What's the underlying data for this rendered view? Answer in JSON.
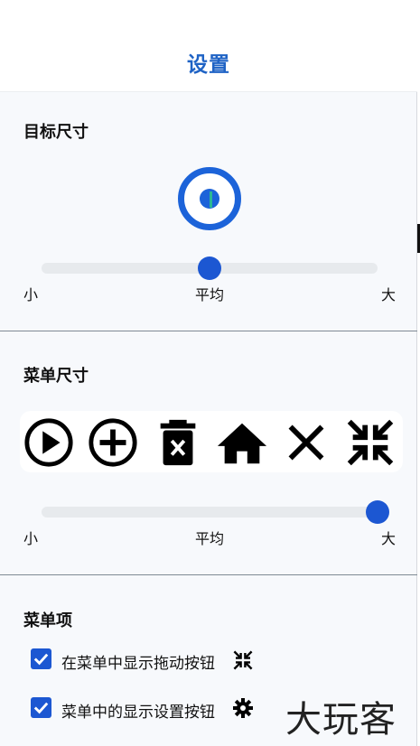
{
  "header": {
    "title": "设置"
  },
  "target_size": {
    "title": "目标尺寸",
    "slider": {
      "min_label": "小",
      "mid_label": "平均",
      "max_label": "大",
      "value_percent": 50
    }
  },
  "menu_size": {
    "title": "菜单尺寸",
    "icons": [
      "play-circle-icon",
      "add-circle-icon",
      "delete-icon",
      "home-icon",
      "close-icon",
      "collapse-icon"
    ],
    "slider": {
      "min_label": "小",
      "mid_label": "平均",
      "max_label": "大",
      "value_percent": 100
    }
  },
  "menu_items": {
    "title": "菜单项",
    "options": [
      {
        "label": "在菜单中显示拖动按钮",
        "checked": true,
        "icon": "collapse-icon"
      },
      {
        "label": "菜单中的显示设置按钮",
        "checked": true,
        "icon": "gear-icon"
      }
    ]
  },
  "watermark": "大玩客",
  "colors": {
    "accent": "#1c57d2",
    "title": "#1f63c5",
    "target_tick": "#2bb894"
  }
}
